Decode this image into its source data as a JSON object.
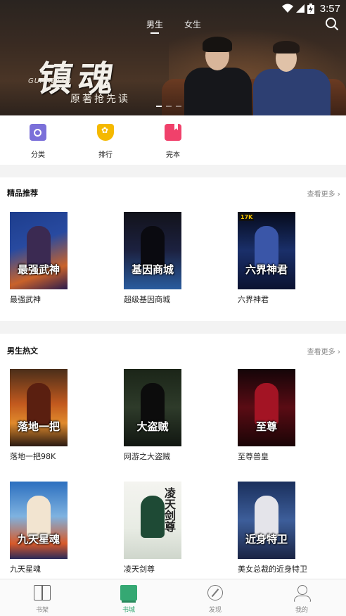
{
  "status_bar": {
    "time": "3:57"
  },
  "top_tabs": [
    {
      "label": "男生",
      "active": true
    },
    {
      "label": "女生",
      "active": false
    }
  ],
  "banner": {
    "title": "镇魂",
    "title_latin": "GUARDIAN",
    "subtitle": "原著抢先读"
  },
  "quick_entries": [
    {
      "label": "分类",
      "icon": "category-icon"
    },
    {
      "label": "排行",
      "icon": "rank-icon"
    },
    {
      "label": "完本",
      "icon": "complete-icon"
    }
  ],
  "sections": {
    "featured": {
      "title": "精品推荐",
      "more": "查看更多",
      "books": [
        {
          "name": "最强武神",
          "cover_text": "最强武神"
        },
        {
          "name": "超级基因商城",
          "cover_text": "基因商城"
        },
        {
          "name": "六界神君",
          "cover_text": "六界神君",
          "badge": "17K"
        }
      ]
    },
    "male_hot": {
      "title": "男生热文",
      "more": "查看更多",
      "books": [
        {
          "name": "落地一把98K",
          "cover_text": "落地一把"
        },
        {
          "name": "网游之大盗贼",
          "cover_text": "大盗贼"
        },
        {
          "name": "至尊兽皇",
          "cover_text": "至尊"
        },
        {
          "name": "九天星魂",
          "cover_text": "九天星魂"
        },
        {
          "name": "凌天剑尊",
          "cover_text": "凌天剑尊"
        },
        {
          "name": "美女总裁的近身特卫",
          "cover_text": "近身特卫"
        }
      ]
    }
  },
  "bottom_nav": [
    {
      "label": "书架",
      "icon": "bookshelf-icon",
      "active": false
    },
    {
      "label": "书城",
      "icon": "bookstore-icon",
      "active": true
    },
    {
      "label": "发现",
      "icon": "discover-icon",
      "active": false
    },
    {
      "label": "我的",
      "icon": "profile-icon",
      "active": false
    }
  ],
  "colors": {
    "accent": "#35a873",
    "category": "#7b70d9",
    "rank": "#f5b900",
    "complete": "#f0416b"
  }
}
